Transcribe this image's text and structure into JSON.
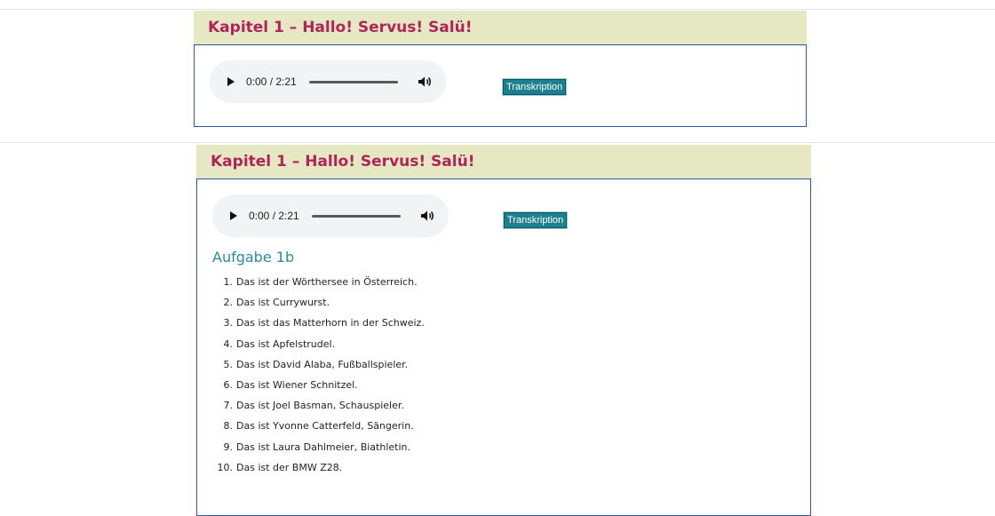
{
  "panel_top": {
    "title": "Kapitel 1 – Hallo! Servus! Salü!",
    "audio": {
      "time": "0:00 / 2:21"
    },
    "transcription_button": "Transkription"
  },
  "panel_bottom": {
    "title": "Kapitel 1 – Hallo! Servus! Salü!",
    "audio": {
      "time": "0:00 / 2:21"
    },
    "transcription_button": "Transkription",
    "section_title": "Aufgabe 1b",
    "items": [
      {
        "num": "1.",
        "text": "Das ist der Wörthersee in Österreich."
      },
      {
        "num": "2.",
        "text": "Das ist Currywurst."
      },
      {
        "num": "3.",
        "text": "Das ist das Matterhorn in der Schweiz."
      },
      {
        "num": "4.",
        "text": "Das ist Apfelstrudel."
      },
      {
        "num": "5.",
        "text": "Das ist David Alaba, Fußballspieler."
      },
      {
        "num": "6.",
        "text": "Das ist Wiener Schnitzel."
      },
      {
        "num": "7.",
        "text": "Das ist Joel Basman, Schauspieler."
      },
      {
        "num": "8.",
        "text": "Das ist Yvonne Catterfeld, Sängerin."
      },
      {
        "num": "9.",
        "text": "Das ist Laura Dahlmeier, Biathletin."
      },
      {
        "num": "10.",
        "text": "Das ist der BMW Z28."
      }
    ]
  },
  "colors": {
    "header_bg": "#e6e8c4",
    "header_text": "#b0245a",
    "box_border": "#2b55a6",
    "button_bg": "#1c8090",
    "section_title": "#2a8aa0"
  }
}
